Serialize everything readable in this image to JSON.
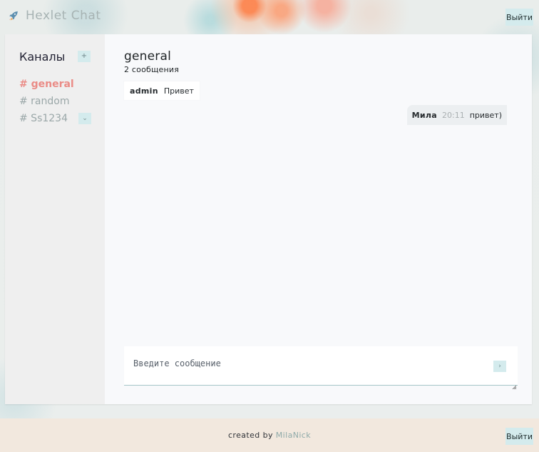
{
  "app": {
    "title": "Hexlet Chat",
    "logout_label": "Выйти"
  },
  "sidebar": {
    "channels_title": "Каналы",
    "add_channel_label": "+",
    "channels": [
      {
        "label": "# general",
        "active": true
      },
      {
        "label": "# random",
        "active": false
      },
      {
        "label": "# Ss1234",
        "active": false,
        "dropdown_label": "⌄"
      }
    ]
  },
  "chat": {
    "channel_name": "general",
    "message_count": "2 сообщения",
    "messages": [
      {
        "author": "admin",
        "text": "Привет"
      },
      {
        "author": "Мила",
        "time": "20:11",
        "text": "привет)"
      }
    ],
    "composer": {
      "placeholder": "Введите сообщение",
      "send_label": "›"
    }
  },
  "footer": {
    "created_by": "created by",
    "author": "MilaNick"
  },
  "colors": {
    "accent": "#d4ebed",
    "active_channel": "#ea8b86",
    "footer_background": "#f2e8de"
  },
  "icons": {
    "brand": "rocket-icon",
    "add_channel": "plus-icon",
    "channel_options": "chevron-down-icon",
    "send": "chevron-right-icon",
    "resize": "resize-handle-icon"
  }
}
